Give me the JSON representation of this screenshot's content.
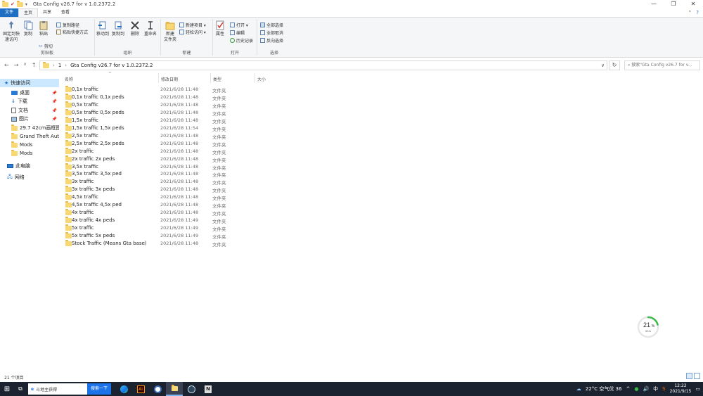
{
  "window": {
    "title": "Gta Config v26.7 for v 1.0.2372.2",
    "controls": [
      "—",
      "❐",
      "✕"
    ]
  },
  "tabs": [
    {
      "label": "文件"
    },
    {
      "label": "主页"
    },
    {
      "label": "共享"
    },
    {
      "label": "查看"
    }
  ],
  "ribbon": {
    "clipboard": {
      "group": "剪贴板",
      "pin": "固定到快\n速访问",
      "copy": "复制",
      "paste": "粘贴",
      "copy_path": "复制路径",
      "paste_shortcut": "粘贴快捷方式",
      "cut": "剪切"
    },
    "organize": {
      "group": "组织",
      "move_to": "移动到",
      "copy_to": "复制到",
      "delete": "删除",
      "rename": "重命名"
    },
    "new": {
      "group": "新建",
      "new_folder": "新建\n文件夹",
      "new_item": "新建项目 ▾",
      "easy_access": "轻松访问 ▾"
    },
    "open": {
      "group": "打开",
      "properties": "属性",
      "open": "打开 ▾",
      "edit": "编辑",
      "history": "历史记录"
    },
    "select": {
      "group": "选择",
      "select_all": "全部选择",
      "select_none": "全部取消",
      "invert": "反向选择"
    }
  },
  "address": {
    "crumb_root": "1",
    "crumb_folder": "Gta Config v26.7 for v 1.0.2372.2",
    "search_placeholder": "搜索\"Gta Config v26.7 for v..."
  },
  "nav_pane": {
    "items": [
      {
        "label": "快速访问",
        "pin": ""
      },
      {
        "label": "桌面",
        "pin": "📌"
      },
      {
        "label": "下载",
        "pin": "📌"
      },
      {
        "label": "文档",
        "pin": "📌"
      },
      {
        "label": "图片",
        "pin": "📌"
      },
      {
        "label": "29.7 42cm画框图纸",
        "pin": ""
      },
      {
        "label": "Grand Theft Auto",
        "pin": ""
      },
      {
        "label": "Mods",
        "pin": ""
      },
      {
        "label": "Mods",
        "pin": ""
      },
      {
        "label": "此电脑",
        "pin": ""
      },
      {
        "label": "网络",
        "pin": ""
      }
    ]
  },
  "columns": {
    "name": "名称",
    "date": "修改日期",
    "type": "类型",
    "size": "大小"
  },
  "files": [
    {
      "name": "0,1x traffic",
      "date": "2021/6/28 11:48",
      "type": "文件夹"
    },
    {
      "name": "0,1x traffic 0,1x peds",
      "date": "2021/6/28 11:48",
      "type": "文件夹"
    },
    {
      "name": "0,5x traffic",
      "date": "2021/6/28 11:48",
      "type": "文件夹"
    },
    {
      "name": "0,5x traffic 0,5x peds",
      "date": "2021/6/28 11:48",
      "type": "文件夹"
    },
    {
      "name": "1,5x traffic",
      "date": "2021/6/28 11:48",
      "type": "文件夹"
    },
    {
      "name": "1,5x traffic 1,5x peds",
      "date": "2021/6/28 11:54",
      "type": "文件夹"
    },
    {
      "name": "2,5x traffic",
      "date": "2021/6/28 11:48",
      "type": "文件夹"
    },
    {
      "name": "2,5x traffic 2,5x peds",
      "date": "2021/6/28 11:48",
      "type": "文件夹"
    },
    {
      "name": "2x traffic",
      "date": "2021/6/28 11:48",
      "type": "文件夹"
    },
    {
      "name": "2x traffic 2x peds",
      "date": "2021/6/28 11:48",
      "type": "文件夹"
    },
    {
      "name": "3,5x traffic",
      "date": "2021/6/28 11:48",
      "type": "文件夹"
    },
    {
      "name": "3,5x traffic 3,5x ped",
      "date": "2021/6/28 11:48",
      "type": "文件夹"
    },
    {
      "name": "3x traffic",
      "date": "2021/6/28 11:48",
      "type": "文件夹"
    },
    {
      "name": "3x traffic 3x peds",
      "date": "2021/6/28 11:48",
      "type": "文件夹"
    },
    {
      "name": "4,5x traffic",
      "date": "2021/6/28 11:48",
      "type": "文件夹"
    },
    {
      "name": "4,5x traffic 4,5x ped",
      "date": "2021/6/28 11:48",
      "type": "文件夹"
    },
    {
      "name": "4x traffic",
      "date": "2021/6/28 11:48",
      "type": "文件夹"
    },
    {
      "name": "4x traffic 4x peds",
      "date": "2021/6/28 11:49",
      "type": "文件夹"
    },
    {
      "name": "5x traffic",
      "date": "2021/6/28 11:49",
      "type": "文件夹"
    },
    {
      "name": "5x traffic 5x peds",
      "date": "2021/6/28 11:49",
      "type": "文件夹"
    },
    {
      "name": "Stock Traffic (Means Gta base)",
      "date": "2021/6/28 11:48",
      "type": "文件夹"
    }
  ],
  "status": {
    "count": "21 个项目"
  },
  "gauge": {
    "percent": "21",
    "unit": "%",
    "speed": "0K/s",
    "fraction": 0.21,
    "color": "#3cb84a"
  },
  "taskbar": {
    "search_text": "斗地主获得",
    "search_button": "搜索一下",
    "weather": "22°C 空气优 36",
    "ime": "中",
    "time": "12:22",
    "date": "2021/9/15"
  },
  "colors": {
    "accent": "#1e6fc3",
    "selection": "#cce8ff",
    "folder": "#f8d775",
    "taskbar": "#1b2331"
  }
}
